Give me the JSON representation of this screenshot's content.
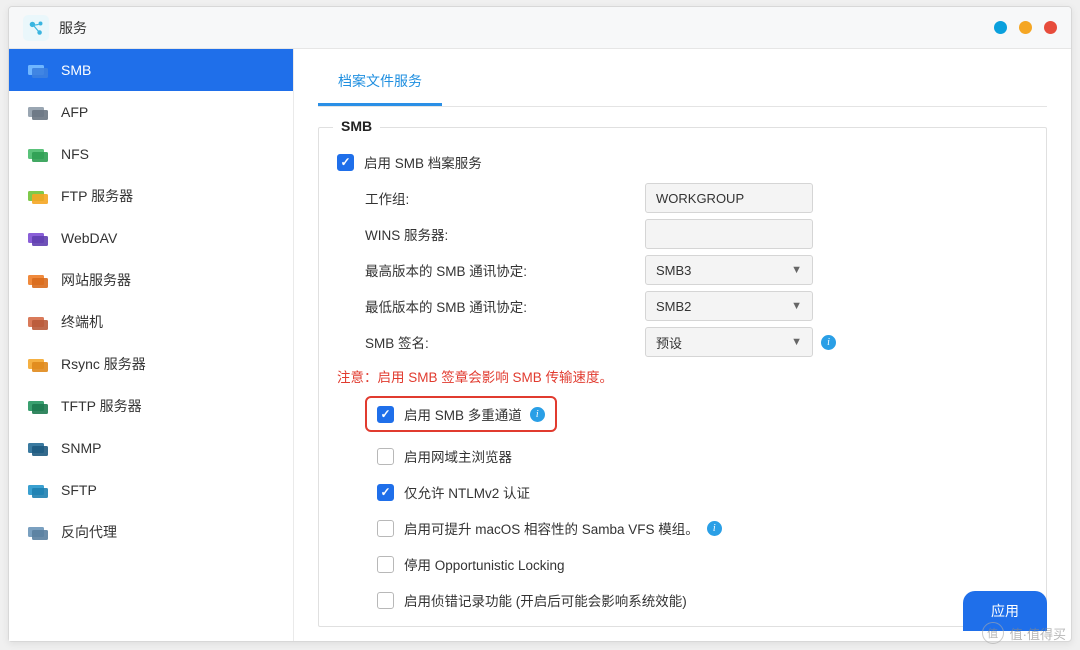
{
  "window": {
    "title": "服务"
  },
  "win_controls": [
    "minimize",
    "maximize",
    "close"
  ],
  "sidebar": {
    "items": [
      {
        "label": "SMB",
        "icon": "smb-icon",
        "active": true,
        "colors": [
          "#6fb6ff",
          "#3b7fe0"
        ]
      },
      {
        "label": "AFP",
        "icon": "afp-icon",
        "colors": [
          "#9aa6b2",
          "#6a7682"
        ]
      },
      {
        "label": "NFS",
        "icon": "nfs-icon",
        "colors": [
          "#5ac27a",
          "#2e9e52"
        ]
      },
      {
        "label": "FTP 服务器",
        "icon": "ftp-icon",
        "colors": [
          "#7fc94a",
          "#f5a623"
        ]
      },
      {
        "label": "WebDAV",
        "icon": "webdav-icon",
        "colors": [
          "#8a5fd8",
          "#5f3fb0"
        ]
      },
      {
        "label": "网站服务器",
        "icon": "web-icon",
        "colors": [
          "#f08a3c",
          "#d86a1c"
        ]
      },
      {
        "label": "终端机",
        "icon": "terminal-icon",
        "colors": [
          "#d97a5a",
          "#b85a3a"
        ]
      },
      {
        "label": "Rsync 服务器",
        "icon": "rsync-icon",
        "colors": [
          "#f5b042",
          "#e08a1c"
        ]
      },
      {
        "label": "TFTP 服务器",
        "icon": "tftp-icon",
        "colors": [
          "#3aa070",
          "#1e7a50"
        ]
      },
      {
        "label": "SNMP",
        "icon": "snmp-icon",
        "colors": [
          "#3a7aa0",
          "#1e5a80"
        ]
      },
      {
        "label": "SFTP",
        "icon": "sftp-icon",
        "colors": [
          "#3aa0d0",
          "#1e80b0"
        ]
      },
      {
        "label": "反向代理",
        "icon": "proxy-icon",
        "colors": [
          "#7aa0c0",
          "#5a80a0"
        ]
      }
    ]
  },
  "tabs": {
    "active": "档案文件服务"
  },
  "section": {
    "legend": "SMB",
    "enable_smb": {
      "label": "启用 SMB 档案服务",
      "checked": true
    },
    "workgroup": {
      "label": "工作组:",
      "value": "WORKGROUP"
    },
    "wins": {
      "label": "WINS 服务器:",
      "value": ""
    },
    "max_proto": {
      "label": "最高版本的 SMB 通讯协定:",
      "value": "SMB3"
    },
    "min_proto": {
      "label": "最低版本的 SMB 通讯协定:",
      "value": "SMB2"
    },
    "signing": {
      "label": "SMB 签名:",
      "value": "预设",
      "info": true
    },
    "warning": "注意：启用 SMB 签章会影响 SMB 传输速度。",
    "opts": [
      {
        "label": "启用 SMB 多重通道",
        "checked": true,
        "info": true,
        "highlight": true
      },
      {
        "label": "启用网域主浏览器",
        "checked": false
      },
      {
        "label": "仅允许 NTLMv2 认证",
        "checked": true
      },
      {
        "label": "启用可提升 macOS 相容性的 Samba VFS 模组。",
        "checked": false,
        "info": true
      },
      {
        "label": "停用 Opportunistic Locking",
        "checked": false
      },
      {
        "label": "启用侦错记录功能 (开启后可能会影响系统效能)",
        "checked": false
      }
    ]
  },
  "apply_label": "应用",
  "watermark": "值·值得买"
}
